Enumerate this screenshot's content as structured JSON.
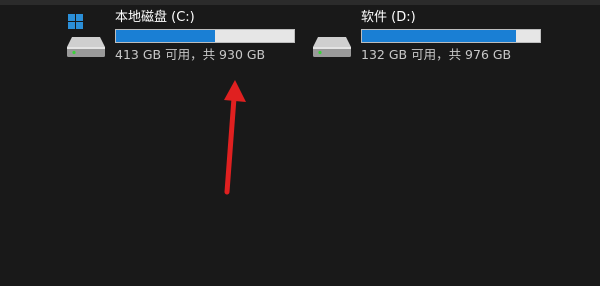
{
  "drives": [
    {
      "name": "本地磁盘 (C:)",
      "free_text": "413 GB 可用，共 930 GB",
      "usage_fraction": 0.556,
      "icon": "system-drive-icon"
    },
    {
      "name": "软件 (D:)",
      "free_text": "132 GB 可用，共 976 GB",
      "usage_fraction": 0.865,
      "icon": "hard-drive-icon"
    }
  ],
  "colors": {
    "background": "#191919",
    "bar_fill": "#1a7fd4",
    "bar_track": "#e6e6e6",
    "arrow": "#e02020",
    "windows_logo": "#2b8fd8"
  }
}
